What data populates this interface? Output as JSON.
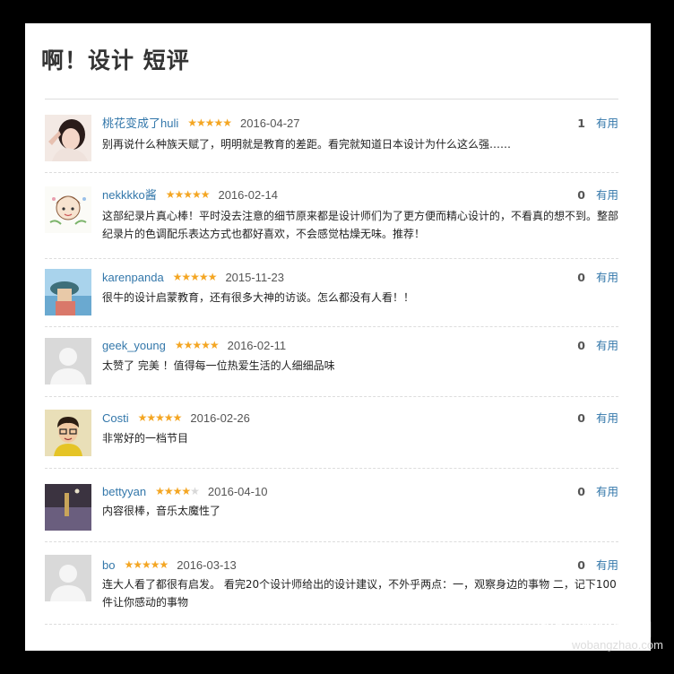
{
  "page": {
    "title": "啊！设计 短评"
  },
  "reviews": [
    {
      "user": "桃花变成了huli",
      "rating": 5,
      "date": "2016-04-27",
      "votes": "1",
      "useful": "有用",
      "text": "别再说什么种族天赋了，明明就是教育的差距。看完就知道日本设计为什么这么强……"
    },
    {
      "user": "nekkkko酱",
      "rating": 5,
      "date": "2016-02-14",
      "votes": "0",
      "useful": "有用",
      "text": "这部纪录片真心棒！平时没去注意的细节原来都是设计师们为了更方便而精心设计的，不看真的想不到。整部纪录片的色调配乐表达方式也都好喜欢，不会感觉枯燥无味。推荐！"
    },
    {
      "user": "karenpanda",
      "rating": 5,
      "date": "2015-11-23",
      "votes": "0",
      "useful": "有用",
      "text": "很牛的设计启蒙教育，还有很多大神的访谈。怎么都没有人看！！"
    },
    {
      "user": "geek_young",
      "rating": 5,
      "date": "2016-02-11",
      "votes": "0",
      "useful": "有用",
      "text": "太赞了 完美 ！值得每一位热爱生活的人细细品味"
    },
    {
      "user": "Costi",
      "rating": 5,
      "date": "2016-02-26",
      "votes": "0",
      "useful": "有用",
      "text": "非常好的一档节目"
    },
    {
      "user": "bettyyan",
      "rating": 4,
      "date": "2016-04-10",
      "votes": "0",
      "useful": "有用",
      "text": "内容很棒，音乐太魔性了"
    },
    {
      "user": "bo",
      "rating": 5,
      "date": "2016-03-13",
      "votes": "0",
      "useful": "有用",
      "text": "连大人看了都很有启发。 看完20个设计师给出的设计建议，不外乎两点：一，观察身边的事物 二，记下100件让你感动的事物"
    }
  ],
  "watermark": {
    "text": "我帮找网",
    "sub": "wobangzhao.com"
  },
  "colors": {
    "link": "#3377aa",
    "star": "#f4a623",
    "background": "#000000"
  }
}
